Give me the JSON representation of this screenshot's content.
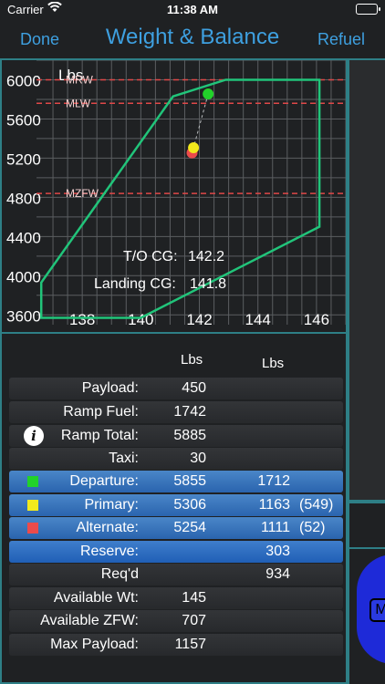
{
  "status_bar": {
    "carrier": "Carrier",
    "time": "11:38 AM"
  },
  "nav": {
    "done_label": "Done",
    "title": "Weight & Balance",
    "refuel_label": "Refuel"
  },
  "chart_data": {
    "type": "line",
    "ylabel": "Lbs",
    "xlim": [
      136.5,
      147
    ],
    "ylim": [
      3500,
      6200
    ],
    "x_ticks": [
      138,
      140,
      142,
      144,
      146
    ],
    "y_ticks": [
      3600,
      4000,
      4400,
      4800,
      5200,
      5600,
      6000
    ],
    "grid": true,
    "envelope": {
      "color": "#21c47a",
      "points": [
        [
          136.6,
          3570
        ],
        [
          136.6,
          3930
        ],
        [
          141.1,
          5830
        ],
        [
          142.9,
          6000
        ],
        [
          146.1,
          6000
        ],
        [
          146.1,
          4500
        ],
        [
          140,
          3570
        ]
      ]
    },
    "limit_lines": [
      {
        "label": "MRW",
        "y": 6000,
        "color": "#e04848"
      },
      {
        "label": "MLW",
        "y": 5760,
        "color": "#e04848"
      },
      {
        "label": "MZFW",
        "y": 4840,
        "color": "#e04848"
      }
    ],
    "points": [
      {
        "name": "Departure",
        "x": 142.3,
        "y": 5855,
        "color": "#22d22a"
      },
      {
        "name": "Primary",
        "x": 141.8,
        "y": 5306,
        "color": "#f2ea1c"
      },
      {
        "name": "Alternate",
        "x": 141.75,
        "y": 5254,
        "color": "#ec4b4b"
      }
    ],
    "annotations": [
      {
        "label": "T/O  CG:",
        "value": "142.2"
      },
      {
        "label": "Landing  CG:",
        "value": "141.8"
      }
    ]
  },
  "table": {
    "headers": [
      "Lbs",
      "Lbs"
    ],
    "rows": [
      {
        "label": "Payload:",
        "v1": "450",
        "v2": "",
        "v3": "",
        "style": "plain"
      },
      {
        "label": "Ramp Fuel:",
        "v1": "1742",
        "v2": "",
        "v3": "",
        "style": "plain"
      },
      {
        "label": "Ramp  Total:",
        "v1": "5885",
        "v2": "",
        "v3": "",
        "style": "plain",
        "icon": "info-icon"
      },
      {
        "label": "Taxi:",
        "v1": "30",
        "v2": "",
        "v3": "",
        "style": "plain"
      },
      {
        "label": "Departure:",
        "v1": "5855",
        "v2": "1712",
        "v3": "",
        "style": "blue",
        "marker_color": "#22d22a"
      },
      {
        "label": "Primary:",
        "v1": "5306",
        "v2": "1163",
        "v3": "(549)",
        "style": "blue",
        "marker_color": "#f2ea1c"
      },
      {
        "label": "Alternate:",
        "v1": "5254",
        "v2": "1111",
        "v3": "(52)",
        "style": "blue",
        "marker_color": "#ec4b4b"
      },
      {
        "label": "Reserve:",
        "v1": "",
        "v2": "303",
        "v3": "",
        "style": "blue2"
      },
      {
        "label": "Req'd",
        "v1": "",
        "v2": "934",
        "v3": "",
        "style": "plain"
      },
      {
        "label": "Available Wt:",
        "v1": "145",
        "v2": "",
        "v3": "",
        "style": "plain"
      },
      {
        "label": "Available ZFW:",
        "v1": "707",
        "v2": "",
        "v3": "",
        "style": "plain"
      },
      {
        "label": "Max Payload:",
        "v1": "1157",
        "v2": "",
        "v3": "",
        "style": "plain"
      }
    ]
  },
  "side_button": {
    "label": "M"
  },
  "colors": {
    "accent": "#3ea0e0",
    "border": "#2e7f86",
    "background": "#1f2123",
    "row_blue": "#2f6fbd"
  }
}
